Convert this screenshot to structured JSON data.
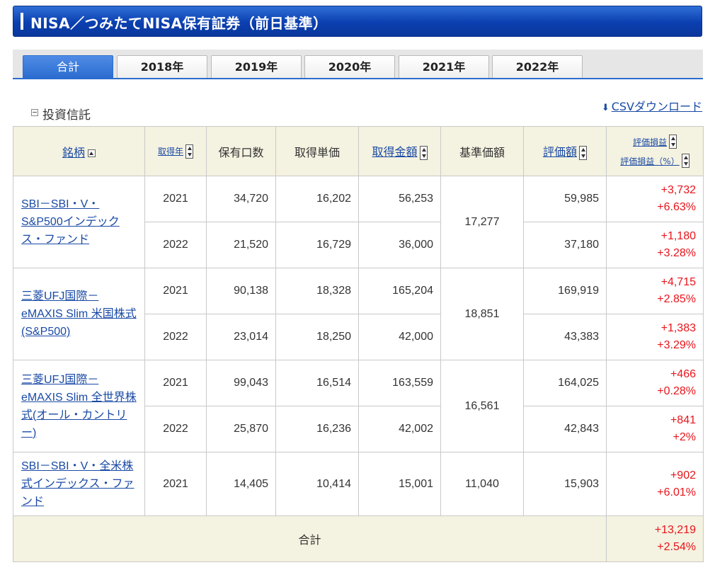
{
  "title": "NISA／つみたてNISA保有証券（前日基準）",
  "tabs": [
    "合計",
    "2018年",
    "2019年",
    "2020年",
    "2021年",
    "2022年"
  ],
  "section": "投資信託",
  "csv_label": "CSVダウンロード",
  "headers": {
    "fund": "銘柄",
    "year": "取得年",
    "units": "保有口数",
    "unit_cost": "取得単価",
    "cost": "取得金額",
    "nav": "基準価額",
    "value": "評価額",
    "gain": "評価損益",
    "gain_pct": "評価損益（%）"
  },
  "funds": [
    {
      "name": "SBI－SBI・V・S&P500インデックス・ファンド",
      "nav": "17,277",
      "rows": [
        {
          "year": "2021",
          "units": "34,720",
          "unit_cost": "16,202",
          "cost": "56,253",
          "value": "59,985",
          "gain": "+3,732",
          "gain_pct": "+6.63%"
        },
        {
          "year": "2022",
          "units": "21,520",
          "unit_cost": "16,729",
          "cost": "36,000",
          "value": "37,180",
          "gain": "+1,180",
          "gain_pct": "+3.28%"
        }
      ]
    },
    {
      "name": "三菱UFJ国際－eMAXIS Slim 米国株式(S&P500)",
      "nav": "18,851",
      "rows": [
        {
          "year": "2021",
          "units": "90,138",
          "unit_cost": "18,328",
          "cost": "165,204",
          "value": "169,919",
          "gain": "+4,715",
          "gain_pct": "+2.85%"
        },
        {
          "year": "2022",
          "units": "23,014",
          "unit_cost": "18,250",
          "cost": "42,000",
          "value": "43,383",
          "gain": "+1,383",
          "gain_pct": "+3.29%"
        }
      ]
    },
    {
      "name": "三菱UFJ国際－eMAXIS Slim 全世界株式(オール・カントリー)",
      "nav": "16,561",
      "rows": [
        {
          "year": "2021",
          "units": "99,043",
          "unit_cost": "16,514",
          "cost": "163,559",
          "value": "164,025",
          "gain": "+466",
          "gain_pct": "+0.28%"
        },
        {
          "year": "2022",
          "units": "25,870",
          "unit_cost": "16,236",
          "cost": "42,002",
          "value": "42,843",
          "gain": "+841",
          "gain_pct": "+2%"
        }
      ]
    },
    {
      "name": "SBI－SBI・V・全米株式インデックス・ファンド",
      "nav": "11,040",
      "rows": [
        {
          "year": "2021",
          "units": "14,405",
          "unit_cost": "10,414",
          "cost": "15,001",
          "value": "15,903",
          "gain": "+902",
          "gain_pct": "+6.01%"
        }
      ]
    }
  ],
  "total": {
    "label": "合計",
    "gain": "+13,219",
    "gain_pct": "+2.54%"
  },
  "colors": {
    "header_blue": "#0b3fb0",
    "tab_active": "#2b6dcf",
    "link": "#1a4aa5",
    "positive": "#e8141b",
    "header_bg": "#f4f2e0"
  }
}
